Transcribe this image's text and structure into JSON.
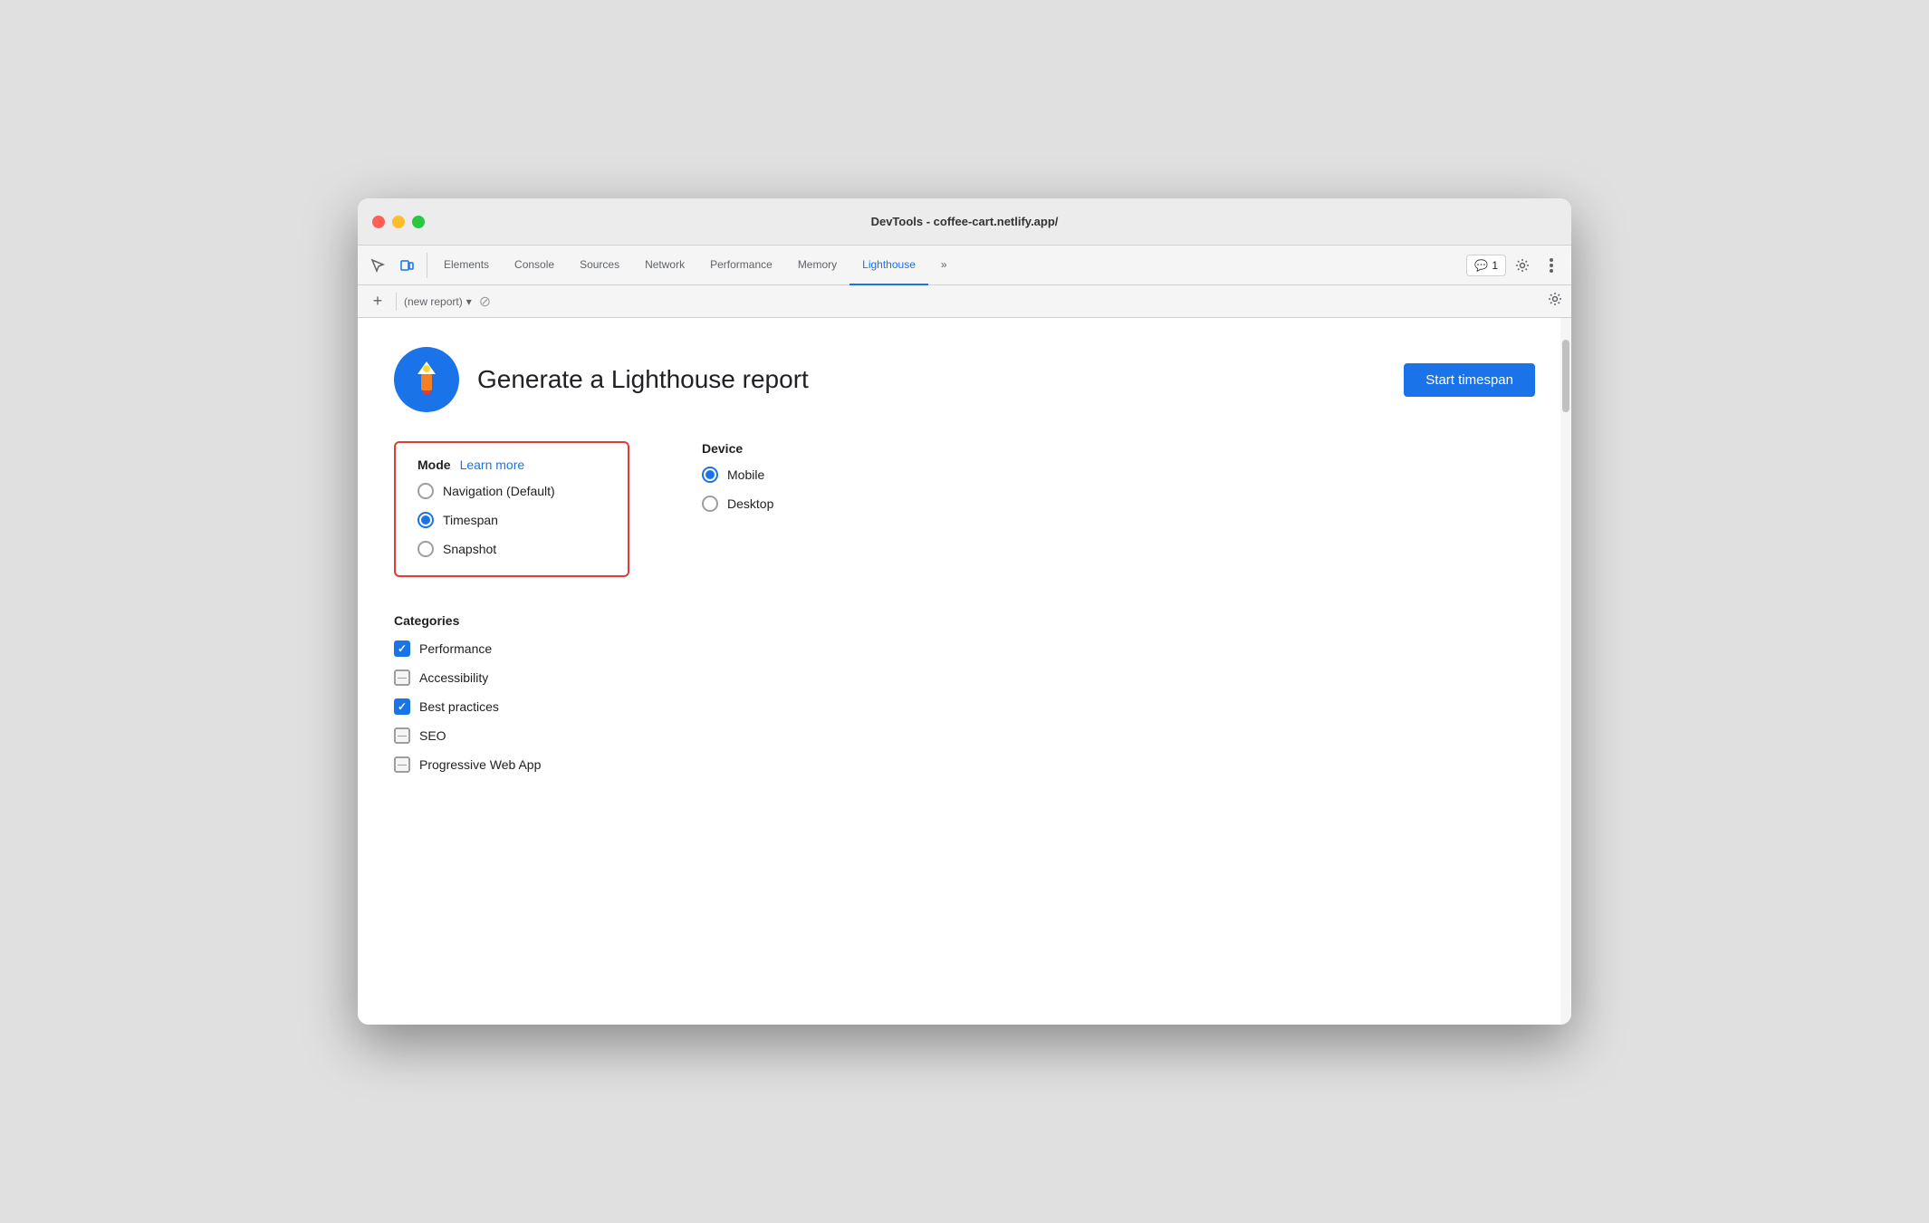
{
  "window": {
    "title": "DevTools - coffee-cart.netlify.app/"
  },
  "devtools": {
    "tabs": [
      {
        "id": "elements",
        "label": "Elements",
        "active": false
      },
      {
        "id": "console",
        "label": "Console",
        "active": false
      },
      {
        "id": "sources",
        "label": "Sources",
        "active": false
      },
      {
        "id": "network",
        "label": "Network",
        "active": false
      },
      {
        "id": "performance",
        "label": "Performance",
        "active": false
      },
      {
        "id": "memory",
        "label": "Memory",
        "active": false
      },
      {
        "id": "lighthouse",
        "label": "Lighthouse",
        "active": true
      }
    ],
    "more_tabs_label": "»",
    "badge_count": "1",
    "new_report_placeholder": "(new report)"
  },
  "lighthouse": {
    "title": "Generate a Lighthouse report",
    "start_button": "Start timespan",
    "mode": {
      "label": "Mode",
      "learn_more": "Learn more",
      "options": [
        {
          "id": "navigation",
          "label": "Navigation (Default)",
          "checked": false
        },
        {
          "id": "timespan",
          "label": "Timespan",
          "checked": true
        },
        {
          "id": "snapshot",
          "label": "Snapshot",
          "checked": false
        }
      ]
    },
    "device": {
      "label": "Device",
      "options": [
        {
          "id": "mobile",
          "label": "Mobile",
          "checked": true
        },
        {
          "id": "desktop",
          "label": "Desktop",
          "checked": false
        }
      ]
    },
    "categories": {
      "label": "Categories",
      "items": [
        {
          "id": "performance",
          "label": "Performance",
          "state": "checked"
        },
        {
          "id": "accessibility",
          "label": "Accessibility",
          "state": "indeterminate"
        },
        {
          "id": "best-practices",
          "label": "Best practices",
          "state": "checked"
        },
        {
          "id": "seo",
          "label": "SEO",
          "state": "indeterminate"
        },
        {
          "id": "pwa",
          "label": "Progressive Web App",
          "state": "indeterminate"
        }
      ]
    }
  }
}
